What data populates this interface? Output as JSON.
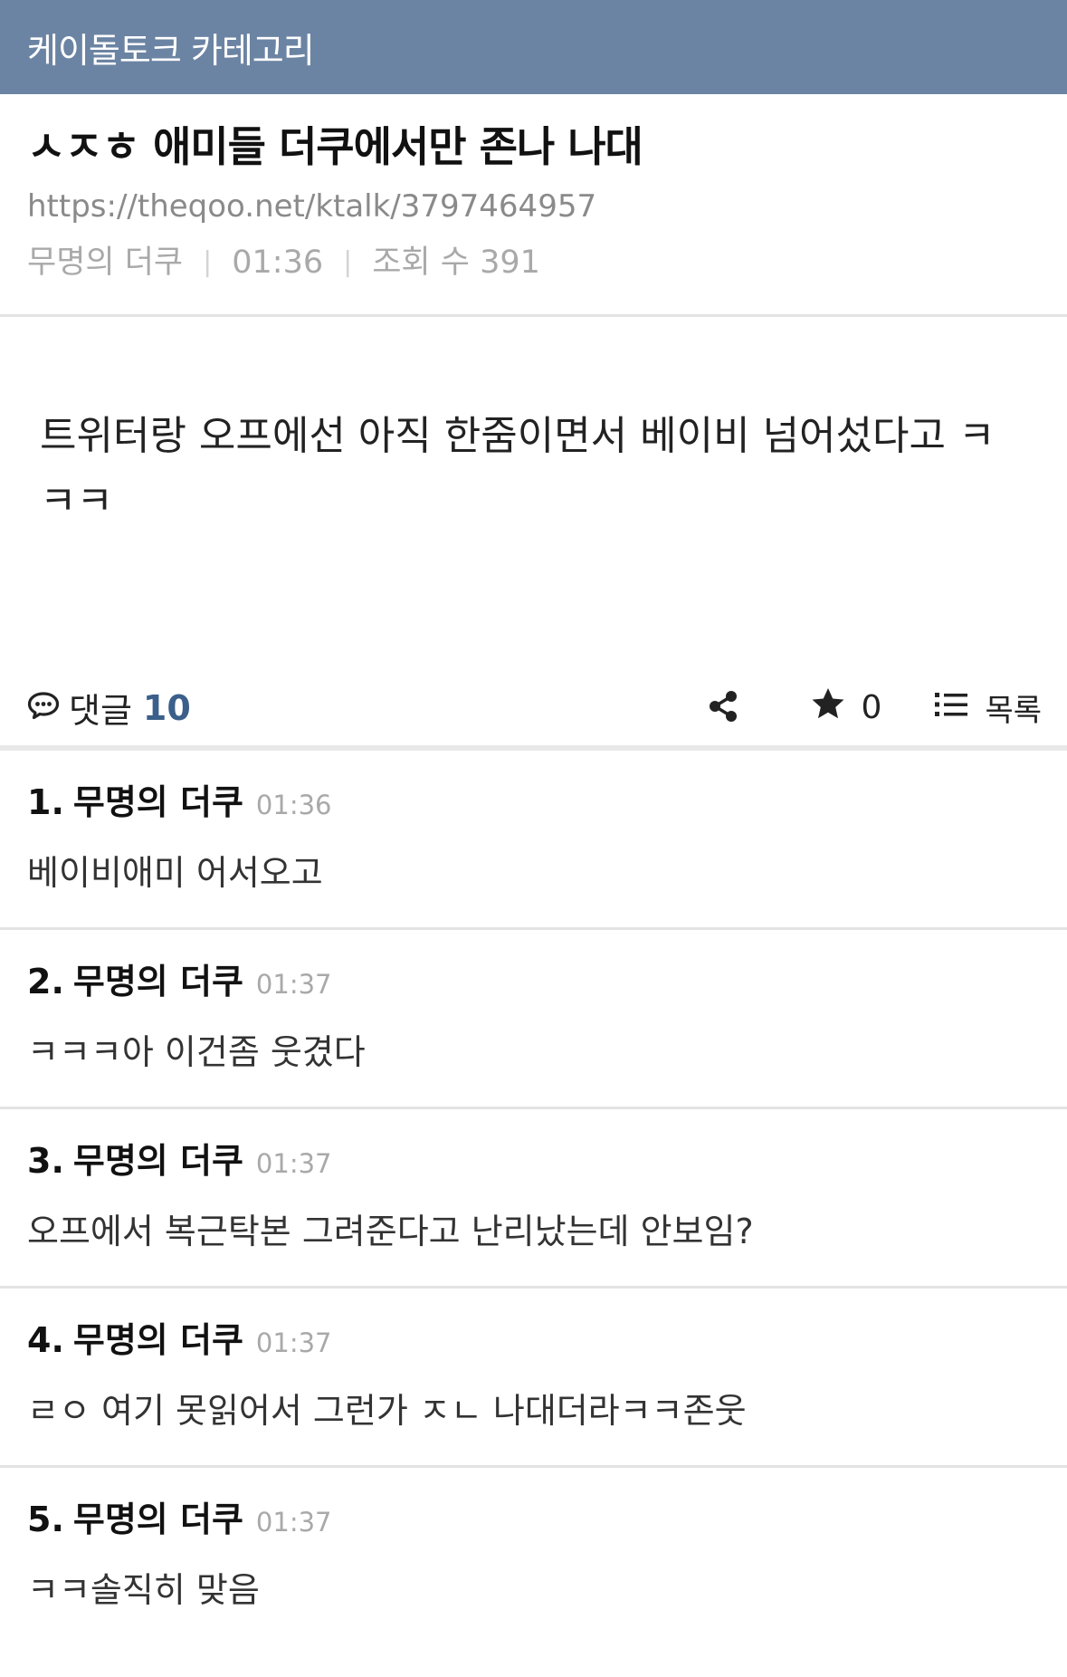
{
  "topbar": {
    "title": "케이돌토크 카테고리"
  },
  "post": {
    "title": "ㅅㅈㅎ 애미들 더쿠에서만 존나 나대",
    "url": "https://theqoo.net/ktalk/3797464957",
    "author": "무명의 더쿠",
    "time": "01:36",
    "views_label": "조회 수 391",
    "body": "트위터랑 오프에선 아직 한줌이면서 베이비 넘어섰다고 ㅋㅋㅋ"
  },
  "actions": {
    "comment_label": "댓글",
    "comment_count": "10",
    "star_count": "0",
    "list_label": "목록"
  },
  "comments": [
    {
      "index": "1.",
      "author": "무명의 더쿠",
      "time": "01:36",
      "text": "베이비애미 어서오고"
    },
    {
      "index": "2.",
      "author": "무명의 더쿠",
      "time": "01:37",
      "text": "ㅋㅋㅋ아 이건좀 웃겼다"
    },
    {
      "index": "3.",
      "author": "무명의 더쿠",
      "time": "01:37",
      "text": "오프에서 복근탁본 그려준다고 난리났는데 안보임?"
    },
    {
      "index": "4.",
      "author": "무명의 더쿠",
      "time": "01:37",
      "text": "ㄹㅇ 여기 못읽어서 그런가 ㅈㄴ 나대더라ㅋㅋ존웃"
    },
    {
      "index": "5.",
      "author": "무명의 더쿠",
      "time": "01:37",
      "text": "ㅋㅋ솔직히 맞음"
    }
  ]
}
